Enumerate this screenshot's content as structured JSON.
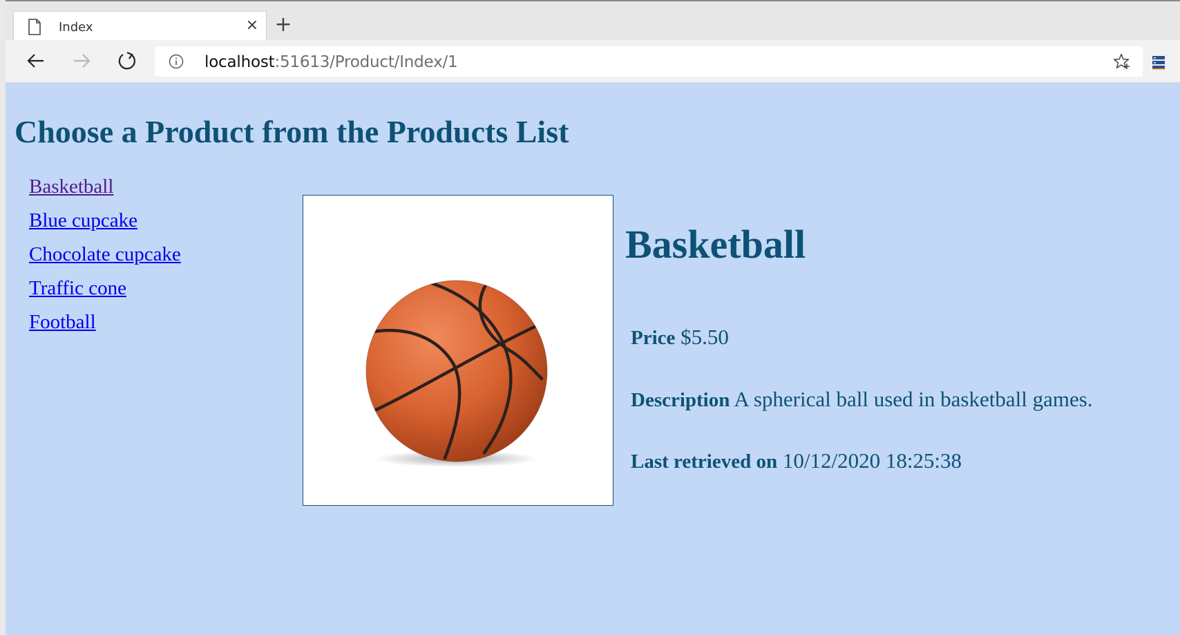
{
  "browser": {
    "tab_title": "Index",
    "tab_close": "×",
    "new_tab": "+",
    "url_host": "localhost",
    "url_path": ":51613/Product/Index/1"
  },
  "page": {
    "title": "Choose a Product from the Products List",
    "products": [
      {
        "label": "Basketball",
        "visited": true
      },
      {
        "label": "Blue cupcake",
        "visited": false
      },
      {
        "label": "Chocolate cupcake",
        "visited": false
      },
      {
        "label": "Traffic cone",
        "visited": false
      },
      {
        "label": "Football",
        "visited": false
      }
    ],
    "selected": {
      "name": "Basketball",
      "price_label": "Price",
      "price": "$5.50",
      "description_label": "Description",
      "description": "A spherical ball used in basketball games.",
      "retrieved_label": "Last retrieved on",
      "retrieved": "10/12/2020 18:25:38"
    }
  },
  "colors": {
    "page_background": "#c3d8f6",
    "heading": "#0d5274",
    "link": "#0000ee",
    "visited_link": "#551a8b"
  },
  "icons": [
    "page-icon",
    "close-icon",
    "plus-icon",
    "back-arrow-icon",
    "forward-arrow-icon",
    "refresh-icon",
    "info-icon",
    "star-icon",
    "extension-icon"
  ]
}
